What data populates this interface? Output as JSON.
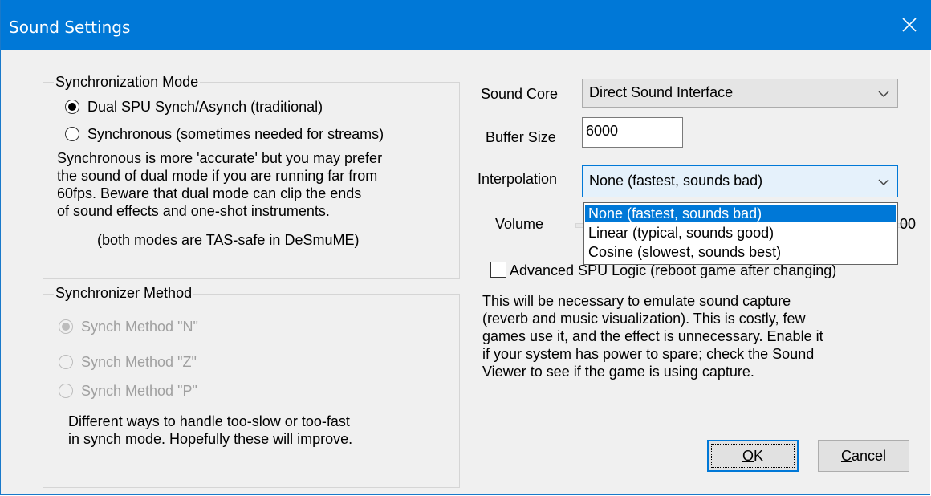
{
  "window": {
    "title": "Sound Settings",
    "close_glyph": "✕"
  },
  "sync_mode": {
    "label": "Synchronization Mode",
    "options": [
      {
        "label": "Dual SPU Synch/Asynch (traditional)",
        "checked": true
      },
      {
        "label": "Synchronous (sometimes needed for streams)",
        "checked": false
      }
    ],
    "description": [
      "Synchronous is more 'accurate' but you may prefer",
      "the sound of dual mode if you are running far from",
      "60fps.  Beware that dual mode can clip the ends",
      "of sound effects and one-shot instruments."
    ],
    "note": "(both modes are TAS-safe in DeSmuME)"
  },
  "sync_method": {
    "label": "Synchronizer Method",
    "options": [
      {
        "label": "Synch Method \"N\"",
        "checked": true
      },
      {
        "label": "Synch Method \"Z\"",
        "checked": false
      },
      {
        "label": "Synch Method \"P\"",
        "checked": false
      }
    ],
    "description": [
      "Different ways to handle too-slow or too-fast",
      "in synch mode. Hopefully these will improve."
    ]
  },
  "sound_core": {
    "label": "Sound Core",
    "value": "Direct Sound Interface"
  },
  "buffer_size": {
    "label": "Buffer Size",
    "value": "6000"
  },
  "interpolation": {
    "label": "Interpolation",
    "value": "None (fastest, sounds bad)",
    "options": [
      "None (fastest, sounds bad)",
      "Linear (typical, sounds good)",
      "Cosine (slowest, sounds best)"
    ]
  },
  "volume": {
    "label": "Volume",
    "value_text_partial": "00"
  },
  "advanced_spu": {
    "label": "Advanced SPU Logic (reboot game after changing)",
    "checked": false,
    "description": [
      "This will be necessary to emulate sound capture",
      "(reverb and music visualization). This is costly, few",
      "games use it, and the effect is unnecessary.  Enable it",
      "if your system has power to spare; check the Sound",
      "Viewer to see if the game is using capture."
    ]
  },
  "buttons": {
    "ok": {
      "mnemonic": "O",
      "rest": "K"
    },
    "cancel": {
      "mnemonic": "C",
      "rest": "ancel"
    }
  }
}
